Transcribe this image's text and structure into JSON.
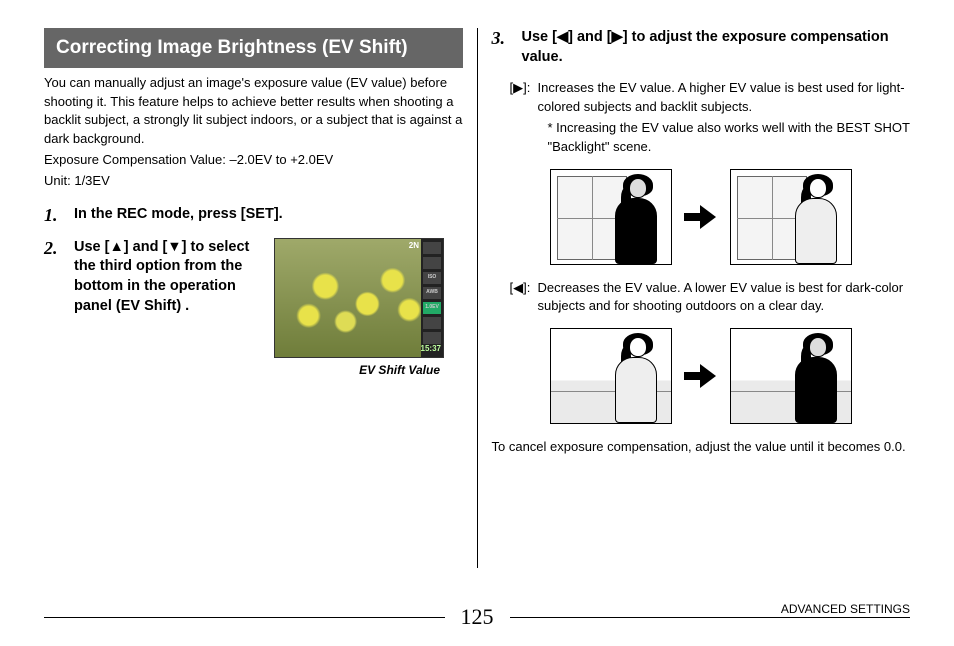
{
  "heading": "Correcting Image Brightness (EV Shift)",
  "intro": {
    "p1": "You can manually adjust an image's exposure value (EV value) before shooting it. This feature helps to achieve better results when shooting a backlit subject, a strongly lit subject indoors, or a subject that is against a dark background.",
    "p2": "Exposure Compensation Value: –2.0EV to +2.0EV",
    "p3": "Unit: 1/3EV"
  },
  "steps": {
    "s1": {
      "num": "1.",
      "text": "In the REC mode, press [SET]."
    },
    "s2": {
      "num": "2.",
      "text": "Use [▲] and [▼] to select the third option from the bottom in the operation panel (EV Shift) .",
      "caption": "EV Shift Value",
      "panel": {
        "iso": "ISO",
        "awb": "AWB",
        "ev": "1.0EV",
        "time": "15:37",
        "quality": "2N"
      }
    },
    "s3": {
      "num": "3.",
      "text": "Use [◀] and [▶] to adjust the exposure compensation value.",
      "right": {
        "key": "[▶]:",
        "line1": "Increases the EV value. A higher EV value is best used for light-colored subjects and backlit subjects.",
        "note": "* Increasing the EV value also works well with the BEST SHOT \"Backlight\" scene."
      },
      "left": {
        "key": "[◀]:",
        "line1": "Decreases the EV value. A lower EV value is best for dark-color subjects and for shooting outdoors on a clear day."
      }
    }
  },
  "cancel": "To cancel exposure compensation, adjust the value until it becomes 0.0.",
  "footer": {
    "page": "125",
    "section": "ADVANCED SETTINGS"
  }
}
